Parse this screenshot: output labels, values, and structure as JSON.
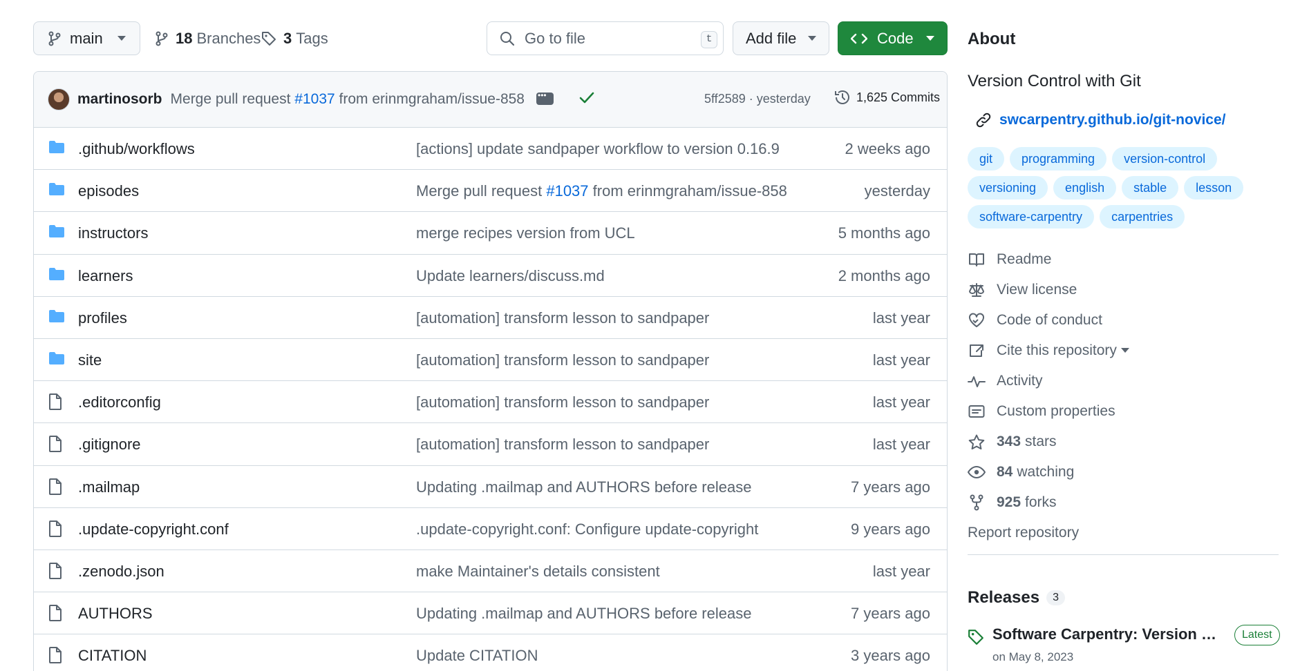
{
  "toolbar": {
    "branch": "main",
    "branches_count": "18",
    "branches_label": "Branches",
    "tags_count": "3",
    "tags_label": "Tags",
    "search_placeholder": "Go to file",
    "search_shortcut": "t",
    "add_file_label": "Add file",
    "code_label": "Code"
  },
  "commit": {
    "author": "martinosorb",
    "message_prefix": "Merge pull request",
    "pr_number": "#1037",
    "message_suffix": "from erinmgraham/issue-858",
    "sha_time": "5ff2589 · yesterday",
    "commits_count": "1,625 Commits"
  },
  "files": [
    {
      "type": "folder",
      "name": ".github/workflows",
      "message": "[actions] update sandpaper workflow to version 0.16.9",
      "age": "2 weeks ago"
    },
    {
      "type": "folder",
      "name": "episodes",
      "message_prefix": "Merge pull request",
      "message_link": "#1037",
      "message_suffix": "from erinmgraham/issue-858",
      "age": "yesterday"
    },
    {
      "type": "folder",
      "name": "instructors",
      "message": "merge recipes version from UCL",
      "age": "5 months ago"
    },
    {
      "type": "folder",
      "name": "learners",
      "message": "Update learners/discuss.md",
      "age": "2 months ago"
    },
    {
      "type": "folder",
      "name": "profiles",
      "message": "[automation] transform lesson to sandpaper",
      "age": "last year"
    },
    {
      "type": "folder",
      "name": "site",
      "message": "[automation] transform lesson to sandpaper",
      "age": "last year"
    },
    {
      "type": "file",
      "name": ".editorconfig",
      "message": "[automation] transform lesson to sandpaper",
      "age": "last year"
    },
    {
      "type": "file",
      "name": ".gitignore",
      "message": "[automation] transform lesson to sandpaper",
      "age": "last year"
    },
    {
      "type": "file",
      "name": ".mailmap",
      "message": "Updating .mailmap and AUTHORS before release",
      "age": "7 years ago"
    },
    {
      "type": "file",
      "name": ".update-copyright.conf",
      "message": ".update-copyright.conf: Configure update-copyright",
      "age": "9 years ago"
    },
    {
      "type": "file",
      "name": ".zenodo.json",
      "message": "make Maintainer's details consistent",
      "age": "last year"
    },
    {
      "type": "file",
      "name": "AUTHORS",
      "message": "Updating .mailmap and AUTHORS before release",
      "age": "7 years ago"
    },
    {
      "type": "file",
      "name": "CITATION",
      "message": "Update CITATION",
      "age": "3 years ago"
    }
  ],
  "about": {
    "title": "About",
    "description": "Version Control with Git",
    "homepage": "swcarpentry.github.io/git-novice/",
    "topics": [
      "git",
      "programming",
      "version-control",
      "versioning",
      "english",
      "stable",
      "lesson",
      "software-carpentry",
      "carpentries"
    ],
    "readme": "Readme",
    "license": "View license",
    "conduct": "Code of conduct",
    "cite": "Cite this repository",
    "activity": "Activity",
    "custom_props": "Custom properties",
    "stars_count": "343",
    "stars_label": "stars",
    "watching_count": "84",
    "watching_label": "watching",
    "forks_count": "925",
    "forks_label": "forks",
    "report": "Report repository"
  },
  "releases": {
    "title": "Releases",
    "count": "3",
    "latest_name": "Software Carpentry: Version Con...",
    "latest_badge": "Latest",
    "latest_date": "on May 8, 2023"
  },
  "colors": {
    "accent": "#0969da",
    "primary_button": "#1f883d",
    "topic_bg": "#ddf4ff",
    "folder_icon": "#54aeff",
    "success": "#1a7f37"
  }
}
